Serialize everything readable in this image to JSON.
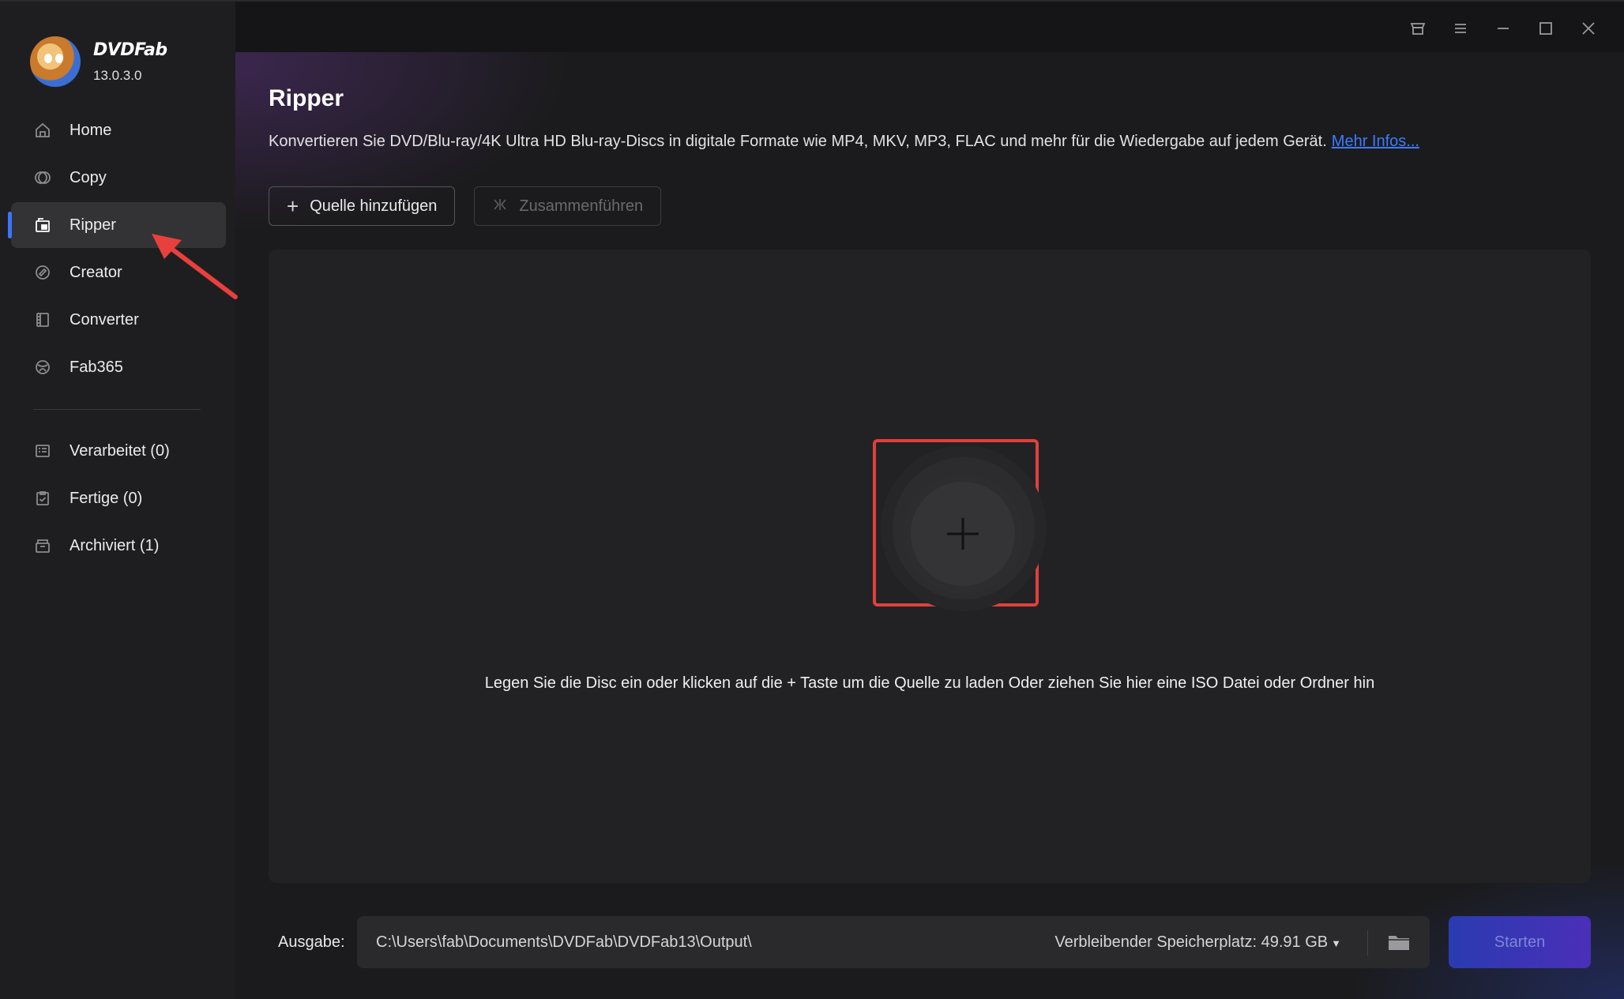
{
  "app": {
    "brand_name": "DVDFab",
    "version": "13.0.3.0"
  },
  "sidebar": {
    "items": [
      {
        "label": "Home",
        "icon": "home-icon",
        "active": false
      },
      {
        "label": "Copy",
        "icon": "copy-icon",
        "active": false
      },
      {
        "label": "Ripper",
        "icon": "ripper-icon",
        "active": true
      },
      {
        "label": "Creator",
        "icon": "creator-icon",
        "active": false
      },
      {
        "label": "Converter",
        "icon": "converter-icon",
        "active": false
      },
      {
        "label": "Fab365",
        "icon": "fab365-icon",
        "active": false
      }
    ],
    "queue": [
      {
        "label": "Verarbeitet (0)",
        "icon": "processing-icon"
      },
      {
        "label": "Fertige (0)",
        "icon": "finished-icon"
      },
      {
        "label": "Archiviert (1)",
        "icon": "archive-icon"
      }
    ]
  },
  "window_controls": [
    "shop-icon",
    "menu-icon",
    "minimize-icon",
    "maximize-icon",
    "close-icon"
  ],
  "main": {
    "title": "Ripper",
    "description": "Konvertieren Sie DVD/Blu-ray/4K Ultra HD Blu-ray-Discs in digitale Formate wie MP4, MKV, MP3, FLAC und mehr für die Wiedergabe auf jedem Gerät.",
    "more_link": "Mehr Infos...",
    "add_source_label": "Quelle hinzufügen",
    "merge_label": "Zusammenführen",
    "drop_hint": "Legen Sie die Disc ein oder klicken auf die + Taste um die Quelle zu laden Oder ziehen Sie hier eine ISO Datei oder Ordner hin"
  },
  "output": {
    "label": "Ausgabe:",
    "path": "C:\\Users\\fab\\Documents\\DVDFab\\DVDFab13\\Output\\",
    "remaining_space": "Verbleibender Speicherplatz: 49.91 GB",
    "start_label": "Starten"
  },
  "colors": {
    "accent": "#3c74ff",
    "highlight": "#e0403c",
    "link": "#3d7bff"
  }
}
